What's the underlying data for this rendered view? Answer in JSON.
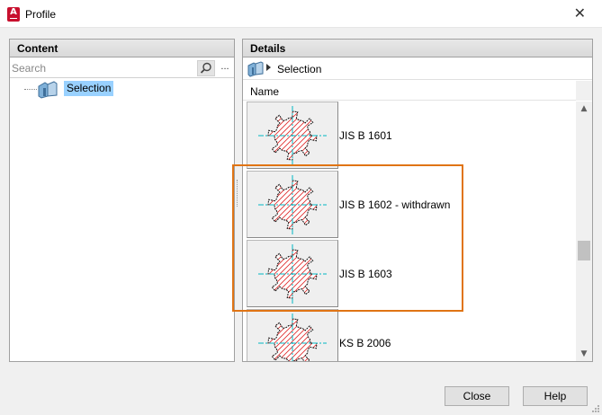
{
  "window": {
    "title": "Profile",
    "app_icon_letter": "A"
  },
  "content_panel": {
    "header": "Content",
    "search": {
      "placeholder": "Search",
      "value": "",
      "more_label": "..."
    },
    "tree": [
      {
        "label": "Selection",
        "selected": true
      }
    ]
  },
  "details_panel": {
    "header": "Details",
    "breadcrumb": "Selection",
    "column_header": "Name",
    "items": [
      {
        "name": "JIS B 1601"
      },
      {
        "name": "JIS B 1602 - withdrawn"
      },
      {
        "name": "JIS B 1603"
      },
      {
        "name": "KS B 2006"
      }
    ]
  },
  "buttons": {
    "close": "Close",
    "help": "Help"
  },
  "colors": {
    "selection": "#99d1ff",
    "highlight_box": "#e07414",
    "hatch": "#e03030",
    "centerline": "#00b7c3",
    "app_icon": "#c8102e"
  }
}
